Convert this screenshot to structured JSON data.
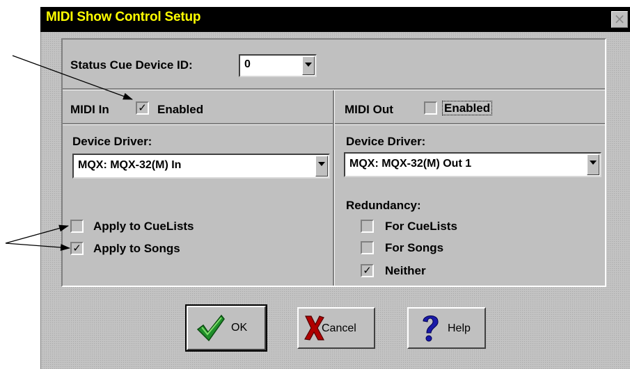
{
  "window": {
    "title": "MIDI Show Control Setup",
    "close_glyph": "×"
  },
  "status_cue": {
    "label": "Status Cue Device ID:",
    "value": "0"
  },
  "midi_in": {
    "label": "MIDI In",
    "enabled_label": "Enabled",
    "enabled": true,
    "device_driver_label": "Device Driver:",
    "device_driver_value": "MQX: MQX-32(M) In",
    "apply_cuelists_label": "Apply to CueLists",
    "apply_cuelists_checked": false,
    "apply_songs_label": "Apply to Songs",
    "apply_songs_checked": true
  },
  "midi_out": {
    "label": "MIDI Out",
    "enabled_label": "Enabled",
    "enabled": false,
    "device_driver_label": "Device Driver:",
    "device_driver_value": "MQX: MQX-32(M) Out 1",
    "redundancy_label": "Redundancy:",
    "for_cuelists_label": "For CueLists",
    "for_songs_label": "For Songs",
    "neither_label": "Neither",
    "redundancy_selected": "Neither"
  },
  "buttons": {
    "ok": "OK",
    "cancel": "Cancel",
    "help": "Help"
  },
  "check_glyph": "✓",
  "icons": {
    "ok": "checkmark-icon",
    "cancel": "x-icon",
    "help": "question-icon",
    "close": "close-icon"
  },
  "colors": {
    "title_bg": "#000000",
    "title_text": "#ffff00",
    "ok_check": "#1f8f2a",
    "cancel_x": "#b00000",
    "help_q": "#1a1aa8"
  }
}
